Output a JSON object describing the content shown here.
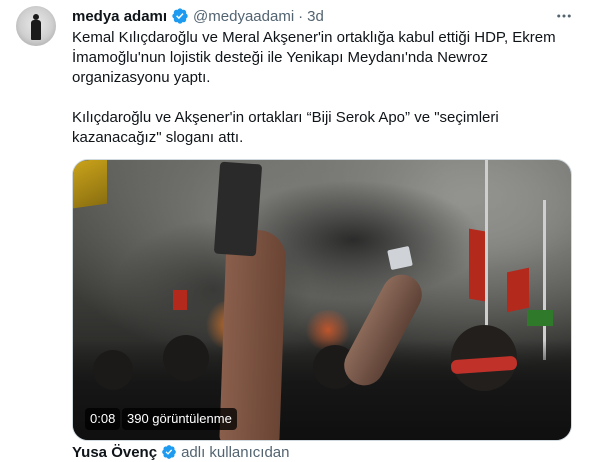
{
  "tweet": {
    "author_name": "medya adamı",
    "author_handle": "@medyaadami",
    "separator": "·",
    "time": "3d",
    "more_icon": "more-icon",
    "paragraphs": [
      "Kemal Kılıçdaroğlu ve Meral Akşener'in ortaklığa kabul ettiği HDP, Ekrem İmamoğlu'nun lojistik desteği ile Yenikapı Meydanı'nda  Newroz organizasyonu yaptı.",
      "Kılıçdaroğlu ve Akşener'in ortakları “Biji Serok Apo” ve \"seçimleri kazanacağız\" sloganı attı."
    ]
  },
  "video": {
    "duration": "0:08",
    "views": "390 görüntülenme"
  },
  "quote": {
    "name": "Yusa Övenç",
    "handle": "adlı kullanıcıdan"
  },
  "colors": {
    "verified": "#1d9bf0",
    "text": "#0f1419",
    "secondary": "#536471"
  }
}
